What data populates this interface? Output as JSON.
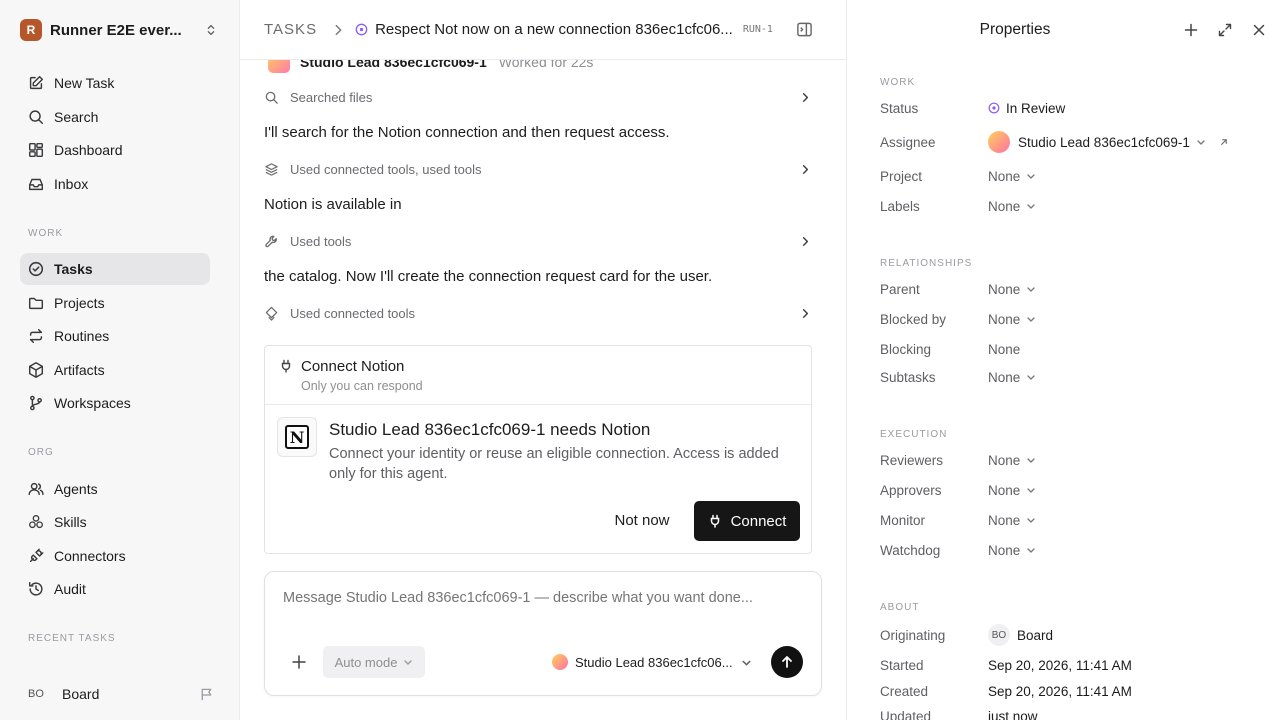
{
  "sidebar": {
    "workspace_logo": "R",
    "workspace_name": "Runner E2E ever...",
    "top_items": [
      {
        "label": "New Task",
        "icon": "new-task-icon"
      },
      {
        "label": "Search",
        "icon": "search-icon"
      },
      {
        "label": "Dashboard",
        "icon": "dashboard-icon"
      },
      {
        "label": "Inbox",
        "icon": "inbox-icon"
      }
    ],
    "work_label": "WORK",
    "work_items": [
      {
        "label": "Tasks",
        "icon": "tasks-icon",
        "active": true
      },
      {
        "label": "Projects",
        "icon": "folder-icon"
      },
      {
        "label": "Routines",
        "icon": "repeat-icon"
      },
      {
        "label": "Artifacts",
        "icon": "box-icon"
      },
      {
        "label": "Workspaces",
        "icon": "branch-icon"
      }
    ],
    "org_label": "ORG",
    "org_items": [
      {
        "label": "Agents",
        "icon": "users-icon"
      },
      {
        "label": "Skills",
        "icon": "skills-icon"
      },
      {
        "label": "Connectors",
        "icon": "plug-icon"
      },
      {
        "label": "Audit",
        "icon": "history-icon"
      }
    ],
    "recent_label": "RECENT TASKS",
    "board_initials": "BO",
    "board_label": "Board"
  },
  "header": {
    "root": "TASKS",
    "title": "Respect Not now on a new connection 836ec1cfc06...",
    "run_id": "RUN-1"
  },
  "feed": {
    "agent_name": "Studio Lead 836ec1cfc069-1",
    "worked_for": "Worked for 22s",
    "tool_searched": "Searched files",
    "msg1": "I'll search for the Notion connection and then request access.",
    "tool_connected_used": "Used connected tools, used tools",
    "msg2": "Notion is available in",
    "tool_used": "Used tools",
    "msg3": "the catalog. Now I'll create the connection request card for the user.",
    "tool_connected": "Used connected tools"
  },
  "connect_card": {
    "title": "Connect Notion",
    "subtitle": "Only you can respond",
    "logo_letter": "N",
    "need_title": "Studio Lead 836ec1cfc069-1 needs Notion",
    "description": "Connect your identity or reuse an eligible connection. Access is added only for this agent.",
    "not_now": "Not now",
    "connect": "Connect"
  },
  "composer": {
    "placeholder": "Message Studio Lead 836ec1cfc069-1 — describe what you want done...",
    "mode": "Auto mode",
    "agent": "Studio Lead 836ec1cfc06..."
  },
  "properties": {
    "title": "Properties",
    "work_label": "WORK",
    "status_key": "Status",
    "status_val": "In Review",
    "assignee_key": "Assignee",
    "assignee_val": "Studio Lead 836ec1cfc069-1",
    "project_key": "Project",
    "labels_key": "Labels",
    "relationships_label": "RELATIONSHIPS",
    "parent_key": "Parent",
    "blocked_by_key": "Blocked by",
    "blocking_key": "Blocking",
    "subtasks_key": "Subtasks",
    "execution_label": "EXECUTION",
    "reviewers_key": "Reviewers",
    "approvers_key": "Approvers",
    "monitor_key": "Monitor",
    "watchdog_key": "Watchdog",
    "about_label": "ABOUT",
    "originating_key": "Originating",
    "originating_initials": "BO",
    "originating_val": "Board",
    "started_key": "Started",
    "started_val": "Sep 20, 2026, 11:41 AM",
    "created_key": "Created",
    "created_val": "Sep 20, 2026, 11:41 AM",
    "updated_key": "Updated",
    "updated_val": "just now",
    "none": "None"
  },
  "colors": {
    "status_in_review": "#8b5cf6",
    "primary_button": "#161616",
    "active_nav": "#e6e6e8"
  }
}
